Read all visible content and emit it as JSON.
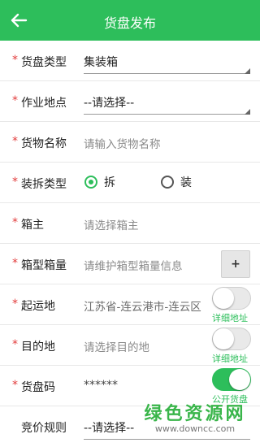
{
  "header": {
    "title": "货盘发布",
    "back_icon": "arrow-left-icon",
    "bg_color": "#2dbe5b"
  },
  "fields": {
    "pallet_type": {
      "label": "货盘类型",
      "value": "集装箱"
    },
    "work_location": {
      "label": "作业地点",
      "value": "--请选择--"
    },
    "goods_name": {
      "label": "货物名称",
      "placeholder": "请输入货物名称"
    },
    "load_type": {
      "label": "装拆类型",
      "options": [
        "拆",
        "装"
      ],
      "selected": "拆"
    },
    "container_owner": {
      "label": "箱主",
      "placeholder": "请选择箱主"
    },
    "container_qty": {
      "label": "箱型箱量",
      "placeholder": "请维护箱型箱量信息",
      "add_label": "+"
    },
    "origin": {
      "label": "起运地",
      "value": "江苏省-连云港市-连云区",
      "toggle_label": "详细地址",
      "toggle_on": false
    },
    "destination": {
      "label": "目的地",
      "placeholder": "请选择目的地",
      "toggle_label": "详细地址",
      "toggle_on": false
    },
    "pallet_code": {
      "label": "货盘码",
      "value": "******",
      "toggle_label": "公开货盘",
      "toggle_on": true
    },
    "bidding_rule": {
      "label": "竞价规则",
      "value": "--请选择--"
    }
  },
  "required_mark": "*",
  "watermark": {
    "main": "绿色资源网",
    "sub": "www.downcc.com"
  }
}
